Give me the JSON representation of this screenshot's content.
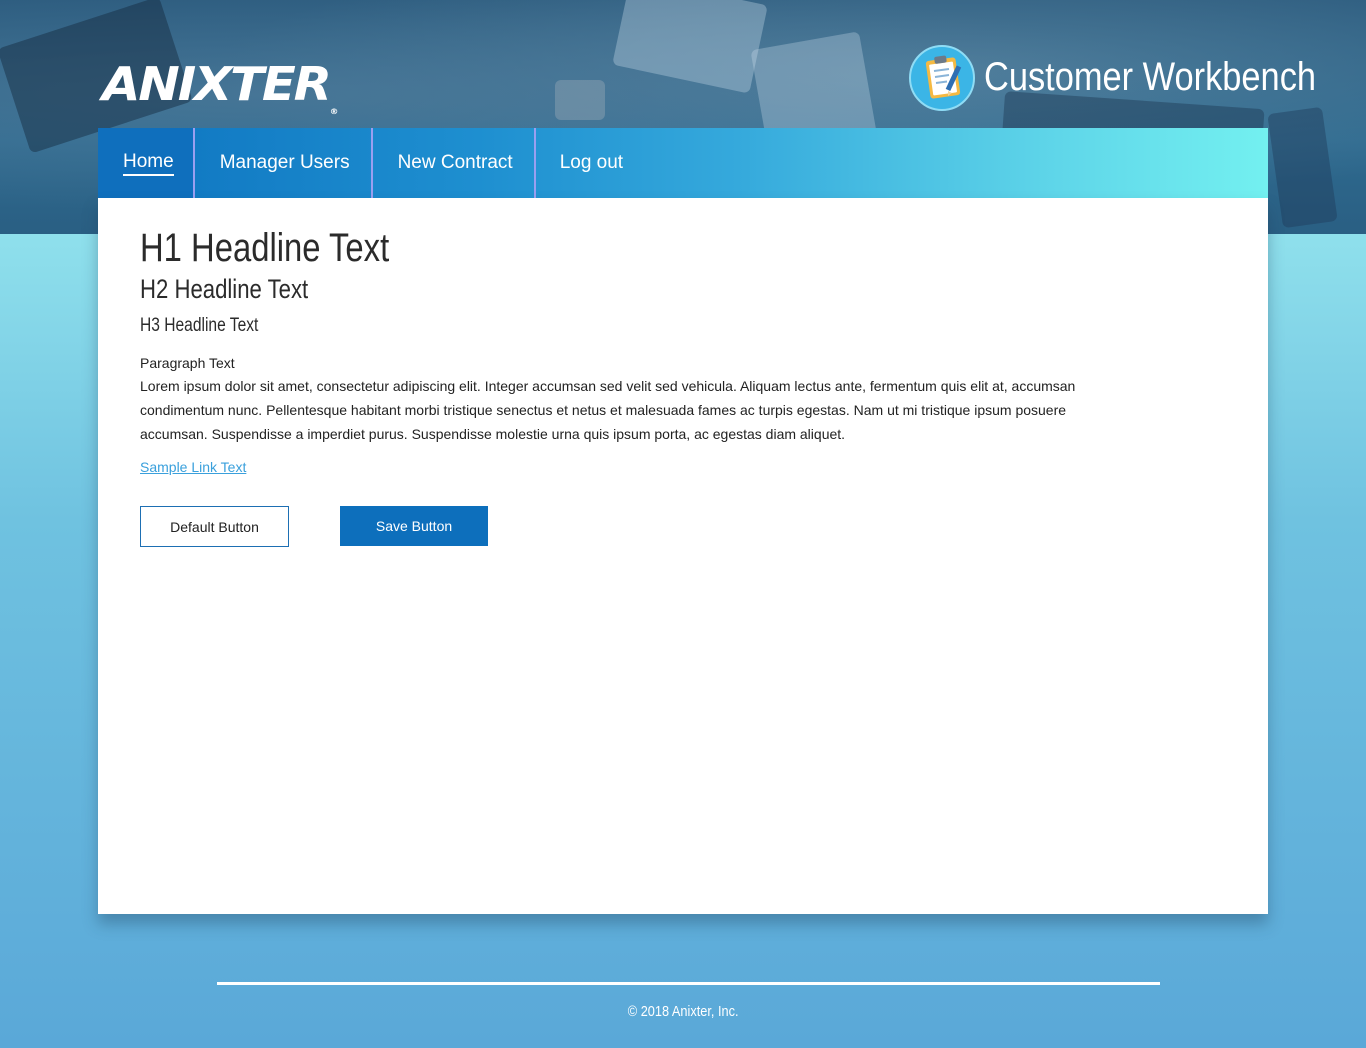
{
  "header": {
    "logo_text": "ANIXTER",
    "logo_mark": "®",
    "app_icon": "clipboard-icon",
    "app_title": "Customer Workbench"
  },
  "nav": {
    "items": [
      {
        "label": "Home",
        "active": true
      },
      {
        "label": "Manager Users",
        "active": false
      },
      {
        "label": "New Contract",
        "active": false
      },
      {
        "label": "Log out",
        "active": false
      }
    ]
  },
  "main": {
    "h1": "H1 Headline Text",
    "h2": "H2 Headline Text",
    "h3": "H3 Headline Text",
    "paragraph_label": "Paragraph Text",
    "paragraph": "Lorem ipsum dolor sit amet, consectetur adipiscing elit. Integer accumsan sed velit sed vehicula. Aliquam lectus ante, fermentum quis elit at, accumsan condimentum nunc. Pellentesque habitant morbi tristique senectus et netus et malesuada fames ac turpis egestas. Nam ut mi tristique ipsum posuere accumsan. Suspendisse a imperdiet purus. Suspendisse molestie urna quis ipsum porta, ac egestas diam aliquet.",
    "link": "Sample Link Text",
    "default_button": "Default Button",
    "save_button": "Save Button"
  },
  "footer": {
    "copyright": "© 2018 Anixter, Inc."
  },
  "colors": {
    "nav_start": "#0e74c0",
    "nav_end": "#73f0f0",
    "primary": "#0d6fbc",
    "link": "#3aa0dc",
    "page_bg_top": "#8fe0ec",
    "page_bg_bottom": "#5aa8d8"
  }
}
